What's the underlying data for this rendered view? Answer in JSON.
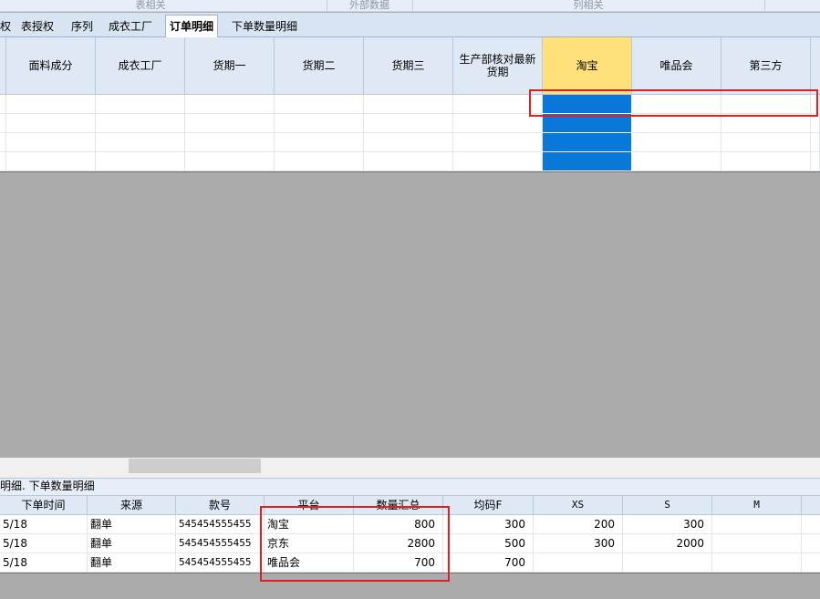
{
  "ribbon": {
    "groups": [
      "表相关",
      "外部数据",
      "列相关"
    ]
  },
  "tabs": [
    "权",
    "表授权",
    "序列",
    "成衣工厂",
    "订单明细",
    "下单数量明细"
  ],
  "active_tab": "订单明细",
  "upper_grid": {
    "columns": [
      "面料成分",
      "成衣工厂",
      "货期一",
      "货期二",
      "货期三",
      "生产部核对最新货期",
      "淘宝",
      "唯品会",
      "第三方"
    ],
    "highlighted_column": "淘宝",
    "row_count": 4
  },
  "lower_panel": {
    "title": "明细. 下单数量明细",
    "columns": [
      "下单时间",
      "来源",
      "款号",
      "平台",
      "数量汇总",
      "均码F",
      "XS",
      "S",
      "M"
    ],
    "rows": [
      [
        "5/18",
        "翻单",
        "545454555455",
        "淘宝",
        "800",
        "300",
        "200",
        "300",
        ""
      ],
      [
        "5/18",
        "翻单",
        "545454555455",
        "京东",
        "2800",
        "500",
        "300",
        "2000",
        ""
      ],
      [
        "5/18",
        "翻单",
        "545454555455",
        "唯品会",
        "700",
        "700",
        "",
        "",
        ""
      ]
    ]
  },
  "colors": {
    "selection": "#0a78d8",
    "header_highlight": "#ffe07a",
    "annotation": "#e02020"
  }
}
